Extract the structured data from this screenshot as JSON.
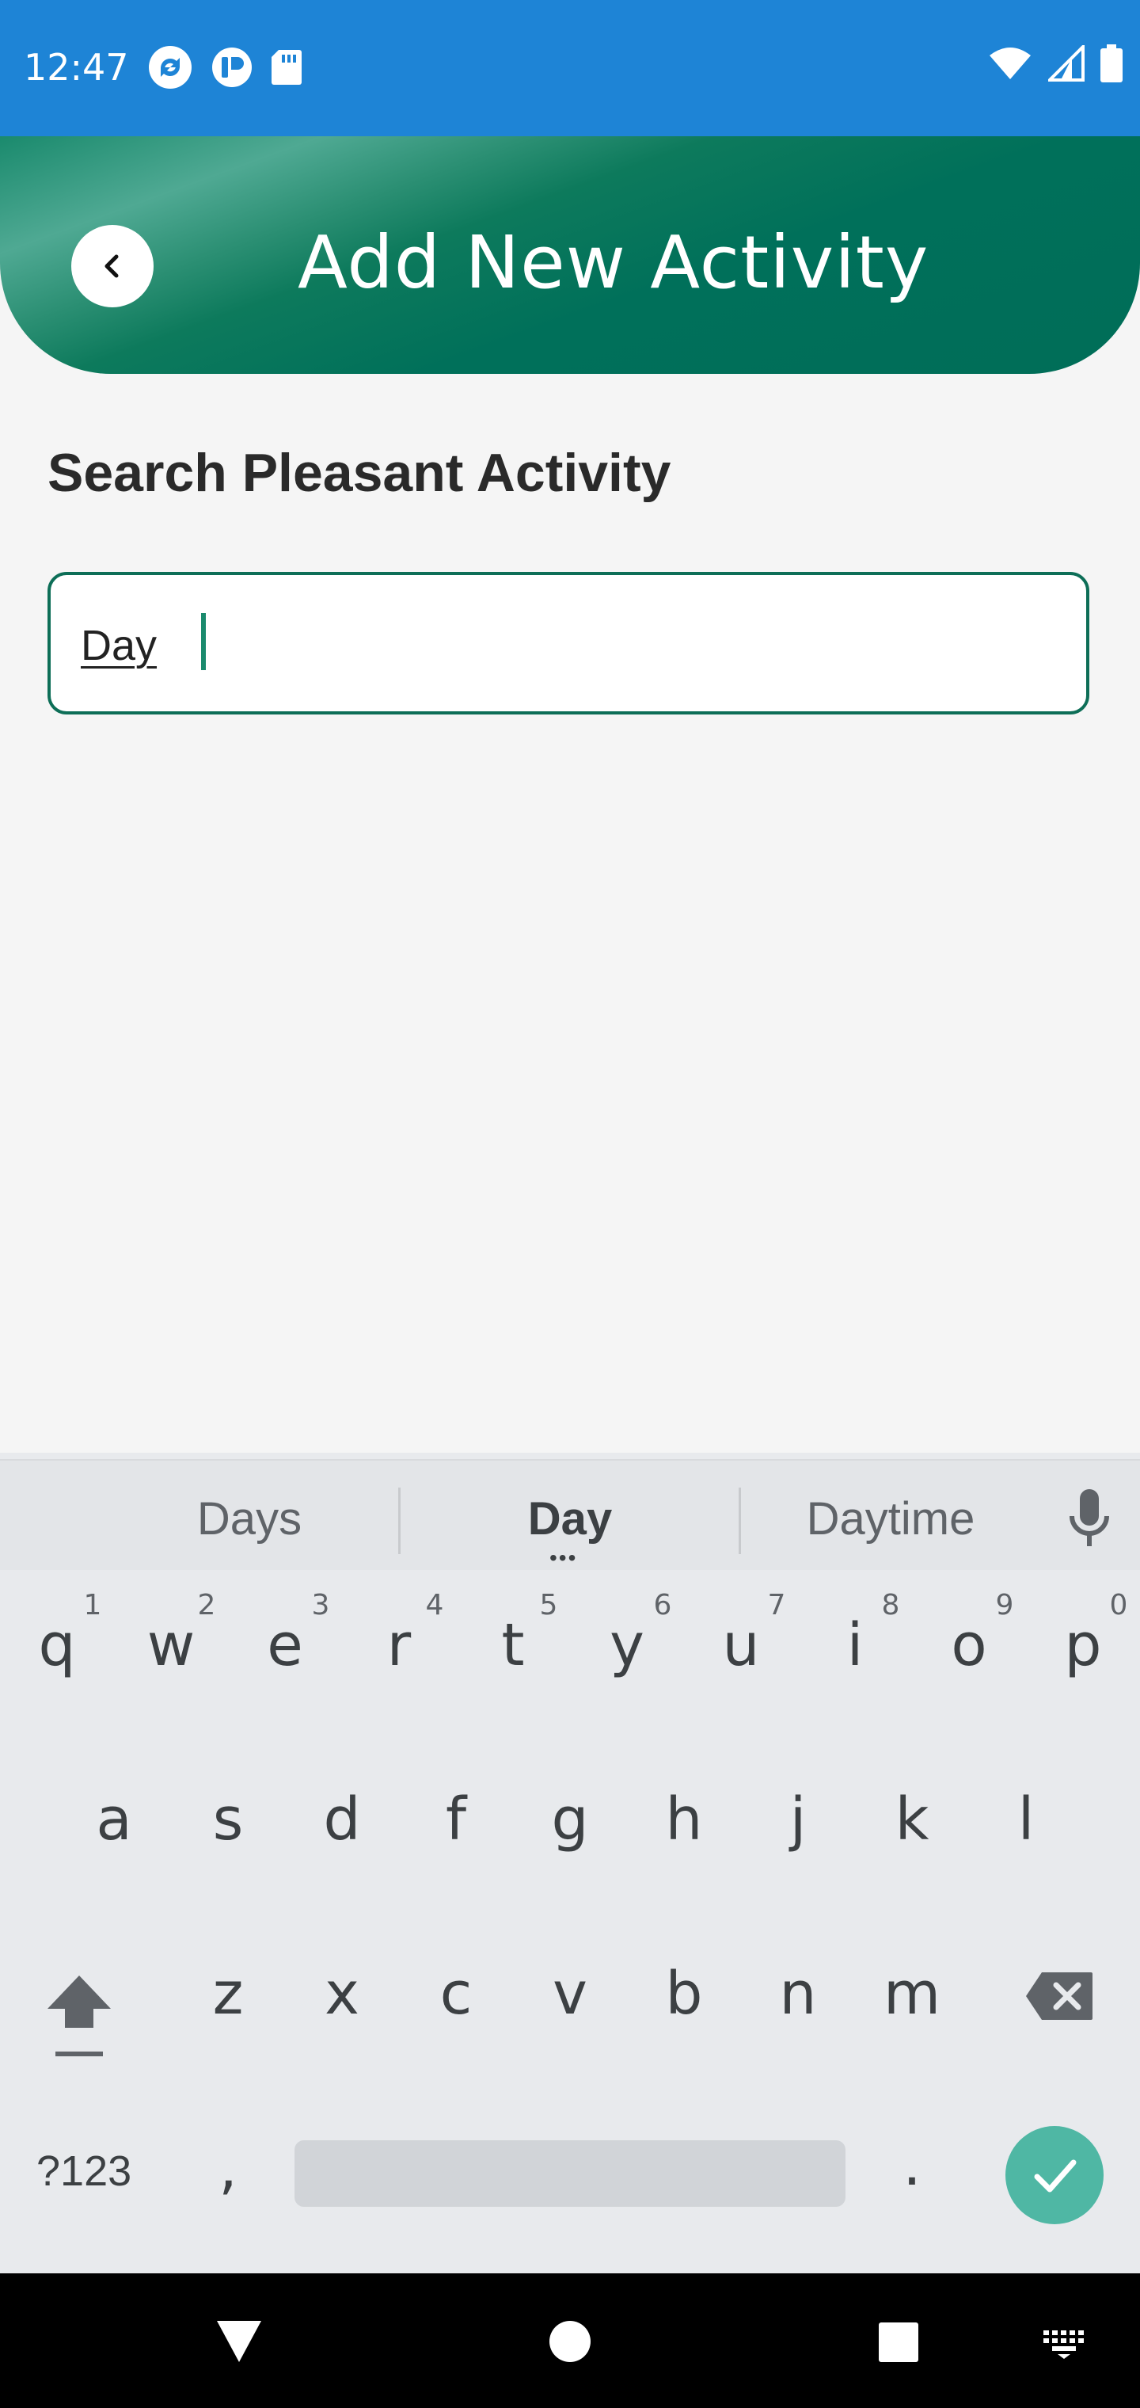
{
  "status_bar": {
    "time": "12:47",
    "left_icons": [
      "sync-icon",
      "app-notification-icon",
      "sd-card-icon"
    ],
    "right_icons": [
      "wifi-icon",
      "cell-signal-icon",
      "battery-icon"
    ]
  },
  "header": {
    "title": "Add New Activity",
    "back_icon": "chevron-left-icon"
  },
  "main": {
    "section_title": "Search Pleasant Activity",
    "search_input": {
      "value": "Day",
      "placeholder": ""
    }
  },
  "keyboard": {
    "suggestions": [
      "Days",
      "Day",
      "Daytime"
    ],
    "row1": [
      {
        "key": "q",
        "hint": "1"
      },
      {
        "key": "w",
        "hint": "2"
      },
      {
        "key": "e",
        "hint": "3"
      },
      {
        "key": "r",
        "hint": "4"
      },
      {
        "key": "t",
        "hint": "5"
      },
      {
        "key": "y",
        "hint": "6"
      },
      {
        "key": "u",
        "hint": "7"
      },
      {
        "key": "i",
        "hint": "8"
      },
      {
        "key": "o",
        "hint": "9"
      },
      {
        "key": "p",
        "hint": "0"
      }
    ],
    "row2": [
      "a",
      "s",
      "d",
      "f",
      "g",
      "h",
      "j",
      "k",
      "l"
    ],
    "row3": [
      "z",
      "x",
      "c",
      "v",
      "b",
      "n",
      "m"
    ],
    "symbols_key": "?123",
    "comma_key": ",",
    "period_key": ".",
    "icons": [
      "mic-icon",
      "shift-icon",
      "backspace-icon",
      "checkmark-icon"
    ]
  },
  "nav_bar": {
    "icons": [
      "back-triangle-icon",
      "home-circle-icon",
      "recents-square-icon",
      "keyboard-icon"
    ]
  },
  "colors": {
    "status_bar": "#1e84d6",
    "header": "#00705a",
    "accent": "#4fb7a4",
    "input_border": "#0d6e57"
  }
}
